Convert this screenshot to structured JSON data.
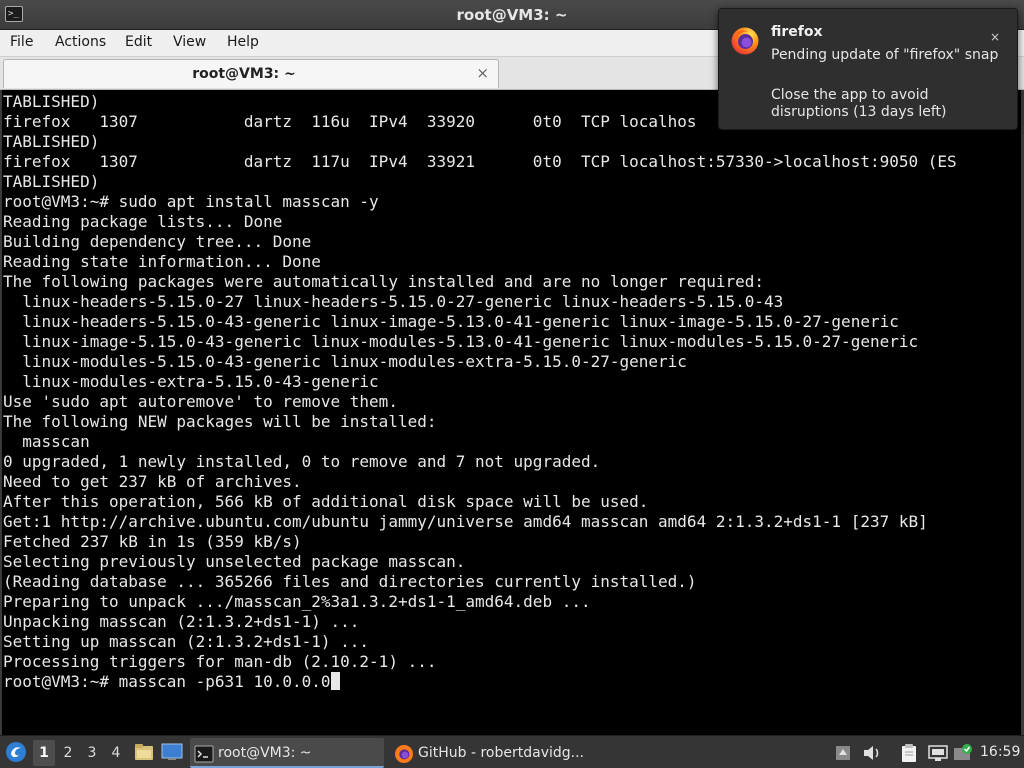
{
  "window": {
    "title": "root@VM3: ~",
    "app_icon_text": ">_"
  },
  "menu": {
    "file": "File",
    "actions": "Actions",
    "edit": "Edit",
    "view": "View",
    "help": "Help"
  },
  "tab": {
    "label": "root@VM3: ~",
    "close": "×"
  },
  "terminal": {
    "lines": [
      "TABLISHED)",
      "firefox   1307           dartz  116u  IPv4  33920      0t0  TCP localhos",
      "TABLISHED)",
      "firefox   1307           dartz  117u  IPv4  33921      0t0  TCP localhost:57330->localhost:9050 (ES",
      "TABLISHED)",
      "root@VM3:~# sudo apt install masscan -y",
      "Reading package lists... Done",
      "Building dependency tree... Done",
      "Reading state information... Done",
      "The following packages were automatically installed and are no longer required:",
      "  linux-headers-5.15.0-27 linux-headers-5.15.0-27-generic linux-headers-5.15.0-43",
      "  linux-headers-5.15.0-43-generic linux-image-5.13.0-41-generic linux-image-5.15.0-27-generic",
      "  linux-image-5.15.0-43-generic linux-modules-5.13.0-41-generic linux-modules-5.15.0-27-generic",
      "  linux-modules-5.15.0-43-generic linux-modules-extra-5.15.0-27-generic",
      "  linux-modules-extra-5.15.0-43-generic",
      "Use 'sudo apt autoremove' to remove them.",
      "The following NEW packages will be installed:",
      "  masscan",
      "0 upgraded, 1 newly installed, 0 to remove and 7 not upgraded.",
      "Need to get 237 kB of archives.",
      "After this operation, 566 kB of additional disk space will be used.",
      "Get:1 http://archive.ubuntu.com/ubuntu jammy/universe amd64 masscan amd64 2:1.3.2+ds1-1 [237 kB]",
      "Fetched 237 kB in 1s (359 kB/s)",
      "Selecting previously unselected package masscan.",
      "(Reading database ... 365266 files and directories currently installed.)",
      "Preparing to unpack .../masscan_2%3a1.3.2+ds1-1_amd64.deb ...",
      "Unpacking masscan (2:1.3.2+ds1-1) ...",
      "Setting up masscan (2:1.3.2+ds1-1) ...",
      "Processing triggers for man-db (2.10.2-1) ..."
    ],
    "prompt_line": "root@VM3:~# masscan -p631 10.0.0.0"
  },
  "notification": {
    "app": "firefox",
    "body": "Pending update of \"firefox\" snap",
    "detail": "Close the app to avoid disruptions (13 days left)",
    "close": "×"
  },
  "taskbar": {
    "workspaces": [
      "1",
      "2",
      "3",
      "4"
    ],
    "active_workspace": "1",
    "tasks": [
      {
        "label": "root@VM3: ~",
        "icon": "terminal-icon",
        "active": true
      },
      {
        "label": "GitHub - robertdavidg...",
        "icon": "firefox-icon",
        "active": false
      }
    ],
    "clock": "16:59"
  },
  "colors": {
    "terminal_bg": "#000000",
    "terminal_fg": "#e8e8e8",
    "titlebar_bg": "#3c3c3c",
    "menubar_bg": "#efefef",
    "taskbar_bg": "#353535",
    "notification_bg": "#2f2f2f"
  }
}
